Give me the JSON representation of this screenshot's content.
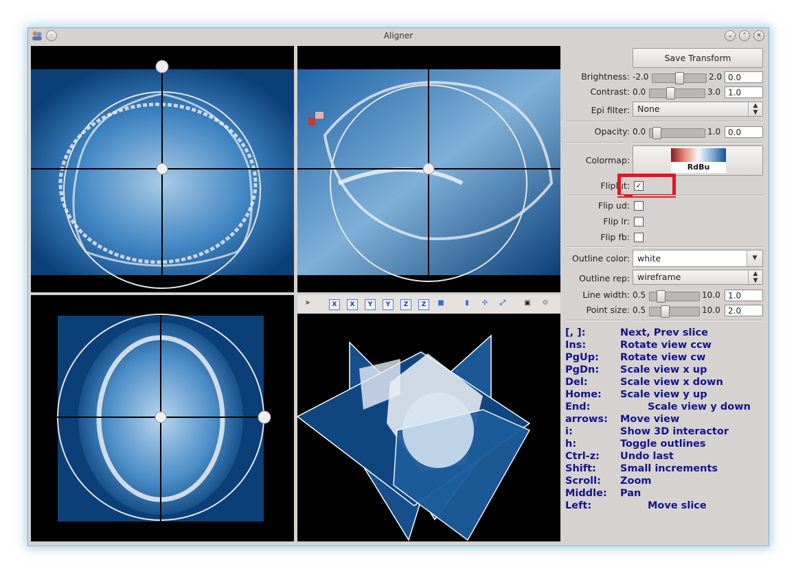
{
  "window": {
    "title": "Aligner"
  },
  "panel": {
    "save_button": "Save Transform",
    "brightness": {
      "label": "Brightness:",
      "min": "-2.0",
      "max": "2.0",
      "value": "0.0",
      "level": 0.5
    },
    "contrast": {
      "label": "Contrast:",
      "min": "0.0",
      "max": "3.0",
      "value": "1.0",
      "level": 0.33
    },
    "epi_filter": {
      "label": "Epi filter:",
      "value": "None"
    },
    "opacity": {
      "label": "Opacity:",
      "min": "0.0",
      "max": "1.0",
      "value": "0.0",
      "level": 0.0
    },
    "colormap": {
      "label": "Colormap:",
      "value": "RdBu"
    },
    "fliplut": {
      "label": "Fliplut:",
      "checked": true
    },
    "flip_ud": {
      "label": "Flip ud:",
      "checked": false
    },
    "flip_lr": {
      "label": "Flip lr:",
      "checked": false
    },
    "flip_fb": {
      "label": "Flip fb:",
      "checked": false
    },
    "outline_color": {
      "label": "Outline color:",
      "value": "white"
    },
    "outline_rep": {
      "label": "Outline rep:",
      "value": "wireframe"
    },
    "line_width": {
      "label": "Line width:",
      "min": "0.5",
      "max": "10.0",
      "value": "1.0",
      "level": 0.05
    },
    "point_size": {
      "label": "Point size:",
      "min": "0.5",
      "max": "10.0",
      "value": "2.0",
      "level": 0.16
    }
  },
  "toolbar": {
    "buttons": [
      "X",
      "X",
      "Y",
      "Y",
      "Z",
      "Z"
    ]
  },
  "help": [
    {
      "key": "[, ]:",
      "desc": "Next, Prev slice"
    },
    {
      "key": "Ins:",
      "desc": "Rotate view ccw"
    },
    {
      "key": "PgUp:",
      "desc": "Rotate view cw"
    },
    {
      "key": "PgDn:",
      "desc": "Scale view x up"
    },
    {
      "key": "Del:",
      "desc": "Scale view x down"
    },
    {
      "key": "Home:",
      "desc": "Scale view y up"
    },
    {
      "key": "End:",
      "desc": "Scale view y down"
    },
    {
      "key": "arrows:",
      "desc": "Move view"
    },
    {
      "key": "i:",
      "desc": "Show 3D interactor"
    },
    {
      "key": "h:",
      "desc": "Toggle outlines"
    },
    {
      "key": "Ctrl-z:",
      "desc": "Undo last"
    },
    {
      "key": "Shift:",
      "desc": "Small increments"
    },
    {
      "key": "Scroll:",
      "desc": "Zoom"
    },
    {
      "key": "Middle:",
      "desc": "Pan"
    },
    {
      "key": "Left:",
      "desc": "Move slice"
    }
  ],
  "colors": {
    "accent_blue": "#13138f",
    "highlight_red": "#e8141c",
    "brain_blue": "#0b3f78"
  }
}
